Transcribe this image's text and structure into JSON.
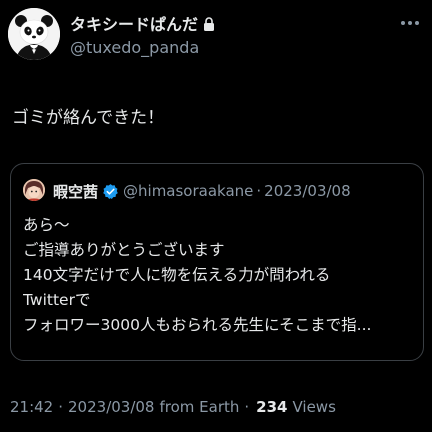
{
  "author": {
    "display_name": "タキシードぱんだ",
    "handle": "@tuxedo_panda",
    "protected": true
  },
  "tweet": {
    "text": "ゴミが絡んできた！"
  },
  "quote": {
    "display_name": "暇空茜",
    "handle": "@himasoraakane",
    "separator": "·",
    "date": "2023/03/08",
    "verified": true,
    "lines": [
      "あら〜",
      "ご指導ありがとうございます",
      "140文字だけで人に物を伝える力が問われる",
      "Twitterで",
      "フォロワー3000人もおられる先生にそこまで指..."
    ]
  },
  "meta": {
    "time": "21:42",
    "separator": "·",
    "date": "2023/03/08",
    "source": "from Earth",
    "views_count": "234",
    "views_label": "Views"
  },
  "icons": {
    "author_avatar": "panda-avatar-icon",
    "lock": "lock-icon",
    "more": "more-options-icon",
    "quote_avatar": "quote-author-avatar-icon",
    "verified": "verified-badge-icon"
  },
  "colors": {
    "background": "#000000",
    "primary_text": "#e7e9ea",
    "secondary_text": "#8b98a5",
    "border": "#3a3f44",
    "verified_blue": "#1d9bf0"
  }
}
